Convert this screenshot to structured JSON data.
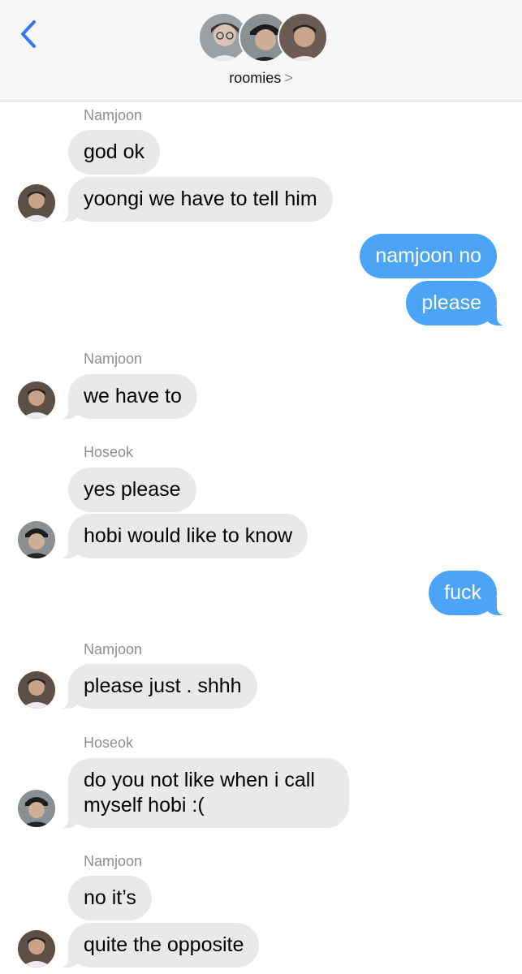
{
  "header": {
    "back_icon": "chevron-left-icon",
    "back_color": "#3478f6",
    "title": "roomies",
    "title_chevron": ">"
  },
  "colors": {
    "incoming_bubble": "#e9e9eb",
    "outgoing_bubble": "#4ba4f5",
    "sender_label": "#8e8e93"
  },
  "messages": {
    "m1_sender": "Namjoon",
    "m1": "god ok",
    "m2": "yoongi we have to tell him",
    "m3": "namjoon no",
    "m4": "please",
    "m5_sender": "Namjoon",
    "m5": "we have to",
    "m6_sender": "Hoseok",
    "m6": "yes please",
    "m7": "hobi would like to know",
    "m8": "fuck",
    "m9_sender": "Namjoon",
    "m9": "please just . shhh",
    "m10_sender": "Hoseok",
    "m10": "do you not like when i call myself hobi :(",
    "m11_sender": "Namjoon",
    "m11": "no it’s",
    "m12": "quite the opposite"
  }
}
